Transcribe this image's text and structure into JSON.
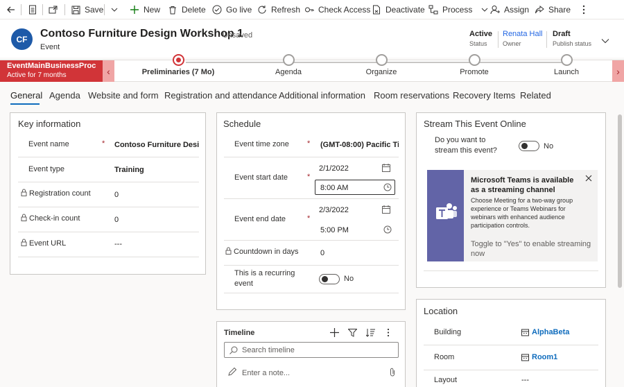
{
  "commands": {
    "save": "Save",
    "new": "New",
    "delete": "Delete",
    "go_live": "Go live",
    "refresh": "Refresh",
    "check_access": "Check Access",
    "deactivate": "Deactivate",
    "process": "Process",
    "assign": "Assign",
    "share": "Share"
  },
  "record": {
    "initials": "CF",
    "title": "Contoso Furniture Design Workshop 1",
    "unsaved": "- Unsaved",
    "entity": "Event"
  },
  "header_fields": [
    {
      "value": "Active",
      "label": "Status"
    },
    {
      "value": "Renata Hall",
      "label": "Owner"
    },
    {
      "value": "Draft",
      "label": "Publish status"
    }
  ],
  "bpf": {
    "name": "EventMainBusinessProce...",
    "active_for": "Active for 7 months",
    "stages": [
      {
        "label": "Preliminaries  (7 Mo)",
        "active": true
      },
      {
        "label": "Agenda",
        "active": false
      },
      {
        "label": "Organize",
        "active": false
      },
      {
        "label": "Promote",
        "active": false
      },
      {
        "label": "Launch",
        "active": false
      }
    ]
  },
  "tabs": [
    "General",
    "Agenda",
    "Website and form",
    "Registration and attendance",
    "Additional information",
    "Room reservations",
    "Recovery Items",
    "Related"
  ],
  "key_info": {
    "title": "Key information",
    "fields": [
      {
        "label": "Event name",
        "value": "Contoso Furniture Desi..."
      },
      {
        "label": "Event type",
        "value": "Training"
      },
      {
        "label": "Registration count",
        "value": "0"
      },
      {
        "label": "Check-in count",
        "value": "0"
      },
      {
        "label": "Event URL",
        "value": "---"
      }
    ]
  },
  "schedule": {
    "title": "Schedule",
    "time_zone_label": "Event time zone",
    "time_zone_value": "(GMT-08:00) Pacific Tim",
    "start_label": "Event start date",
    "start_date": "2/1/2022",
    "start_time": "8:00 AM",
    "end_label": "Event end date",
    "end_date": "2/3/2022",
    "end_time": "5:00 PM",
    "countdown_label": "Countdown in days",
    "countdown_value": "0",
    "recurring_label_1": "This is a recurring",
    "recurring_label_2": "event",
    "recurring_value": "No"
  },
  "timeline": {
    "title": "Timeline",
    "search_placeholder": "Search timeline",
    "note_placeholder": "Enter a note..."
  },
  "stream": {
    "title": "Stream This Event Online",
    "question_1": "Do you want to",
    "question_2": "stream this event?",
    "value": "No",
    "card_title": "Microsoft Teams is available as a streaming channel",
    "card_body": "Choose Meeting for a two-way group experience or Teams Webinars for webinars with enhanced audience participation controls.",
    "card_footer": "Toggle to \"Yes\" to enable streaming now"
  },
  "location": {
    "title": "Location",
    "building_label": "Building",
    "building_value": "AlphaBeta",
    "room_label": "Room",
    "room_value": "Room1",
    "layout_label": "Layout",
    "layout_value": "---"
  },
  "colors": {
    "accent": "#0f6cbd",
    "bpf_flag": "#d13438",
    "avatar": "#1e5aa8",
    "teams": "#6264a7"
  }
}
